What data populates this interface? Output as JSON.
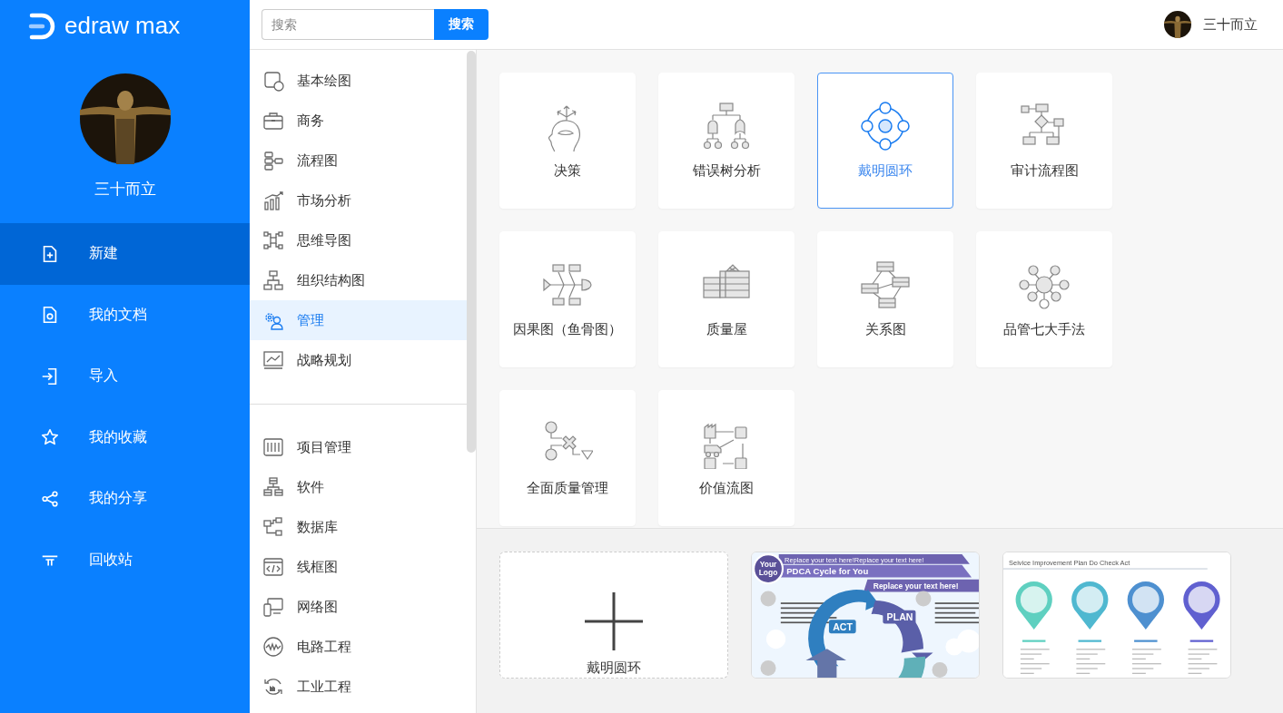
{
  "logo": {
    "text": "edraw max"
  },
  "user": {
    "name": "三十而立"
  },
  "nav": [
    {
      "label": "新建",
      "selected": true
    },
    {
      "label": "我的文档",
      "selected": false
    },
    {
      "label": "导入",
      "selected": false
    },
    {
      "label": "我的收藏",
      "selected": false
    },
    {
      "label": "我的分享",
      "selected": false
    },
    {
      "label": "回收站",
      "selected": false
    }
  ],
  "search": {
    "placeholder": "搜索",
    "button": "搜索"
  },
  "header_user": {
    "name": "三十而立"
  },
  "categories": [
    {
      "label": "基本绘图",
      "selected": false
    },
    {
      "label": "商务",
      "selected": false
    },
    {
      "label": "流程图",
      "selected": false
    },
    {
      "label": "市场分析",
      "selected": false
    },
    {
      "label": "思维导图",
      "selected": false
    },
    {
      "label": "组织结构图",
      "selected": false
    },
    {
      "label": "管理",
      "selected": true
    },
    {
      "label": "战略规划",
      "selected": false
    }
  ],
  "more_categories": [
    {
      "label": "项目管理",
      "selected": false
    },
    {
      "label": "软件",
      "selected": false
    },
    {
      "label": "数据库",
      "selected": false
    },
    {
      "label": "线框图",
      "selected": false
    },
    {
      "label": "网络图",
      "selected": false
    },
    {
      "label": "电路工程",
      "selected": false
    },
    {
      "label": "工业工程",
      "selected": false
    }
  ],
  "diagram_types": [
    {
      "label": "决策",
      "selected": false
    },
    {
      "label": "错误树分析",
      "selected": false
    },
    {
      "label": "戴明圆环",
      "selected": true
    },
    {
      "label": "审计流程图",
      "selected": false
    },
    {
      "label": "因果图（鱼骨图）",
      "selected": false
    },
    {
      "label": "质量屋",
      "selected": false
    },
    {
      "label": "关系图",
      "selected": false
    },
    {
      "label": "品管七大手法",
      "selected": false
    },
    {
      "label": "全面质量管理",
      "selected": false
    },
    {
      "label": "价值流图",
      "selected": false
    }
  ],
  "templates": [
    {
      "kind": "blank",
      "label": "戴明圆环"
    },
    {
      "kind": "pdca",
      "logo": "Your Logo",
      "banner": "Replace your text here!Replace your text here!",
      "title": "PDCA Cycle for You",
      "subtitle": "Replace your text here!",
      "act": "ACT",
      "plan": "PLAN"
    },
    {
      "kind": "service",
      "title": "Seivice Improvement Plan Do Check Act"
    }
  ]
}
